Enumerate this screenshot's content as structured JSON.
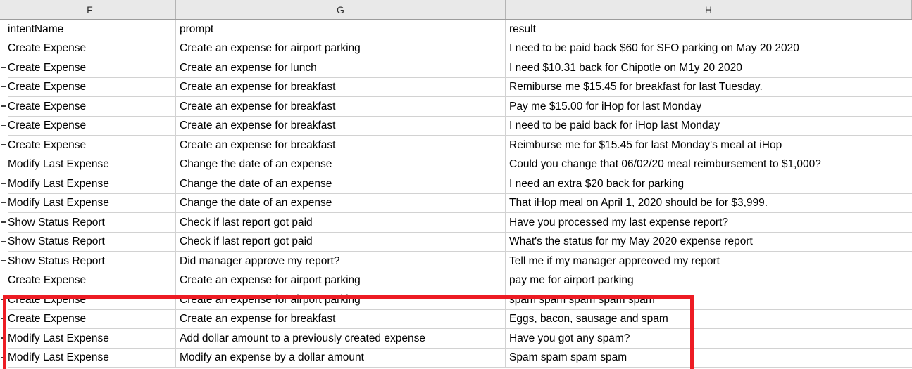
{
  "app": {
    "type": "spreadsheet",
    "accent_red": "#ed1c24",
    "header_bg": "#e9e9e9",
    "gridline": "#d2d2d2",
    "text_color": "#000000"
  },
  "column_headers": [
    {
      "letter": "",
      "name": "column-header-e"
    },
    {
      "letter": "F",
      "name": "column-header-f"
    },
    {
      "letter": "G",
      "name": "column-header-g"
    },
    {
      "letter": "H",
      "name": "column-header-h"
    }
  ],
  "table": {
    "header": {
      "intentName": "intentName",
      "prompt": "prompt",
      "result": "result"
    },
    "rows": [
      {
        "intentName": "Create Expense",
        "prompt": "Create an expense for airport parking",
        "result": "I need to be paid back $60 for SFO parking on May 20 2020",
        "highlighted": false
      },
      {
        "intentName": "Create Expense",
        "prompt": "Create an expense for lunch",
        "result": "I need $10.31 back for Chipotle on M1y 20 2020",
        "highlighted": false
      },
      {
        "intentName": "Create Expense",
        "prompt": "Create an expense for breakfast",
        "result": "Remiburse me $15.45 for breakfast for last Tuesday.",
        "highlighted": false
      },
      {
        "intentName": "Create Expense",
        "prompt": "Create an expense for breakfast",
        "result": "Pay me $15.00 for iHop for last Monday",
        "highlighted": false
      },
      {
        "intentName": "Create Expense",
        "prompt": "Create an expense for breakfast",
        "result": "I need to be paid back for iHop last Monday",
        "highlighted": false
      },
      {
        "intentName": "Create Expense",
        "prompt": "Create an expense for breakfast",
        "result": "Reimburse me for $15.45 for last Monday's meal at iHop",
        "highlighted": false
      },
      {
        "intentName": "Modify Last Expense",
        "prompt": "Change the date of an expense",
        "result": "Could you change that 06/02/20 meal reimbursement to $1,000?",
        "highlighted": false
      },
      {
        "intentName": "Modify Last Expense",
        "prompt": "Change the date of an expense",
        "result": "I need an extra $20 back for parking",
        "highlighted": false
      },
      {
        "intentName": "Modify Last Expense",
        "prompt": "Change the date of an expense",
        "result": "That iHop meal on April 1, 2020 should be for $3,999.",
        "highlighted": false
      },
      {
        "intentName": "Show Status Report",
        "prompt": "Check if last report got paid",
        "result": "Have you processed my last expense report?",
        "highlighted": false
      },
      {
        "intentName": "Show Status Report",
        "prompt": "Check if last report got paid",
        "result": "What's the status for my May 2020 expense report",
        "highlighted": false
      },
      {
        "intentName": "Show Status Report",
        "prompt": "Did manager approve my report?",
        "result": "Tell me if my manager appreoved my report",
        "highlighted": false
      },
      {
        "intentName": "Create Expense",
        "prompt": "Create an expense for airport parking",
        "result": "pay me for airport parking",
        "highlighted": false
      },
      {
        "intentName": "Create Expense",
        "prompt": "Create an expense for airport parking",
        "result": "spam spam spam spam spam",
        "highlighted": true
      },
      {
        "intentName": "Create Expense",
        "prompt": "Create an expense for breakfast",
        "result": "Eggs, bacon, sausage and spam",
        "highlighted": true
      },
      {
        "intentName": "Modify Last Expense",
        "prompt": "Add dollar amount to a previously created expense",
        "result": "Have you got any spam?",
        "highlighted": true
      },
      {
        "intentName": "Modify Last Expense",
        "prompt": "Modify an expense by a dollar amount",
        "result": "Spam spam spam spam",
        "highlighted": true
      }
    ]
  },
  "annotation": {
    "shape": "rectangle",
    "color": "#ed1c24",
    "label": "highlighted-spam-rows"
  }
}
